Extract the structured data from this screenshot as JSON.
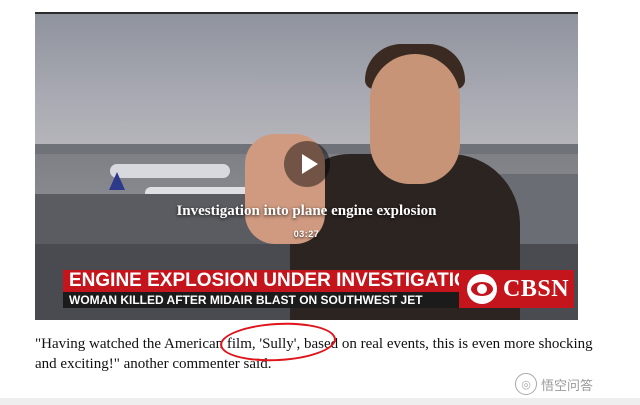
{
  "video": {
    "title": "Investigation into plane engine explosion",
    "duration": "03:27",
    "chyron_headline": "ENGINE EXPLOSION UNDER INVESTIGATION",
    "chyron_subline": "WOMAN KILLED AFTER MIDAIR BLAST ON SOUTHWEST JET",
    "network_logo": "CBSN",
    "play_icon": "play-icon",
    "accent_color": "#c4151c"
  },
  "article": {
    "caption_text": "\"Having watched the American film, 'Sully', based on real events, this is even more shocking and exciting!\" another commenter said.",
    "highlight_color": "#e0131a"
  },
  "watermark": {
    "icon": "wukong-icon",
    "text": "悟空问答"
  }
}
